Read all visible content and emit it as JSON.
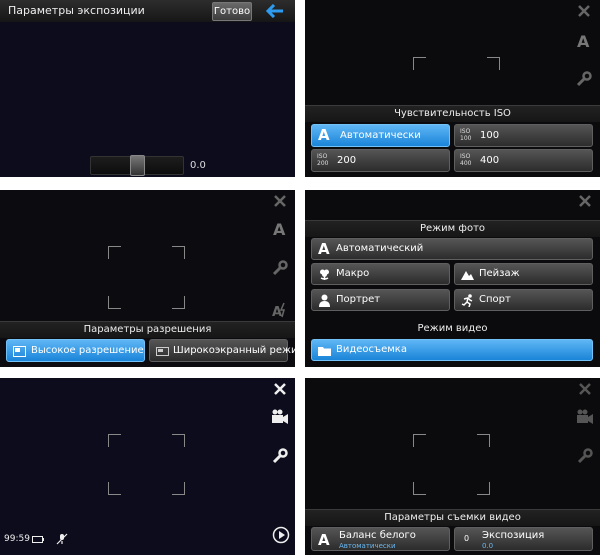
{
  "exposure_screen": {
    "title": "Параметры экспозиции",
    "done_label": "Готово",
    "slider_value_text": "0.0",
    "slider_level": 0.5
  },
  "iso_screen": {
    "header": "Чувствительность ISO",
    "options": [
      {
        "label": "Автоматически",
        "tag": "",
        "selected": true
      },
      {
        "label": "100",
        "tag": "ISO 100",
        "selected": false
      },
      {
        "label": "200",
        "tag": "ISO 200",
        "selected": false
      },
      {
        "label": "400",
        "tag": "ISO 400",
        "selected": false
      }
    ]
  },
  "resolution_screen": {
    "header": "Параметры разрешения",
    "options": [
      {
        "label": "Высокое разрешение",
        "selected": true
      },
      {
        "label": "Широкоэкранный режим",
        "selected": false
      }
    ]
  },
  "scene_screen": {
    "photo_header": "Режим фото",
    "auto_label": "Автоматический",
    "macro_label": "Макро",
    "landscape_label": "Пейзаж",
    "portrait_label": "Портрет",
    "sport_label": "Спорт",
    "video_header": "Режим видео",
    "video_label": "Видеосъемка"
  },
  "video_screen": {
    "time_remaining": "99:59"
  },
  "video_settings_screen": {
    "header": "Параметры съемки видео",
    "white_balance_label": "Баланс белого",
    "white_balance_value": "Автоматически",
    "exposure_badge": "0",
    "exposure_label": "Экспозиция",
    "exposure_value": "0.0"
  },
  "colors": {
    "accent": "#1a84d8",
    "background": "#0a0a12"
  },
  "icons": [
    "close-icon",
    "auto-letter-icon",
    "wrench-icon",
    "flash-auto-icon",
    "video-camera-icon",
    "play-icon",
    "back-arrow-icon"
  ]
}
